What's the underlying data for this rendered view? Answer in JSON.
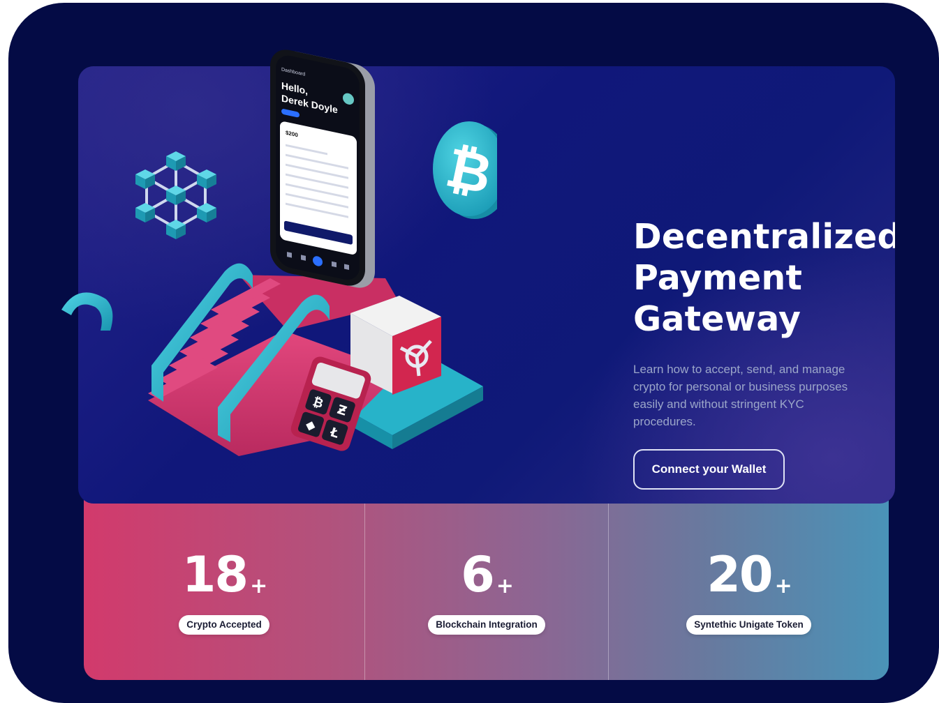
{
  "hero": {
    "title": "Decentralized\nPayment\nGateway",
    "description": "Learn how to accept, send, and manage crypto for personal or business purposes easily and without stringent KYC procedures.",
    "connect_button": "Connect your Wallet"
  },
  "phone_screen": {
    "header": "Dashboard",
    "greeting": "Hello,",
    "name": "Derek Doyle",
    "balance": "$200"
  },
  "stats": [
    {
      "value": "18",
      "suffix": "+",
      "label": "Crypto Accepted"
    },
    {
      "value": "6",
      "suffix": "+",
      "label": "Blockchain Integration"
    },
    {
      "value": "20",
      "suffix": "+",
      "label": "Syntethic Unigate Token"
    }
  ],
  "colors": {
    "background": "#040b45",
    "hero_gradient_mid": "#10177a",
    "stats_gradient_left": "#d23a6c",
    "stats_gradient_right": "#4a93b8",
    "accent_teal": "#27b3c9",
    "accent_pink": "#d8336f"
  },
  "icons": {
    "coin": "bitcoin-coin-icon",
    "cube_network": "blockchain-cube-icon",
    "wallet_device": "crypto-wallet-device-icon",
    "safe": "safe-icon"
  }
}
